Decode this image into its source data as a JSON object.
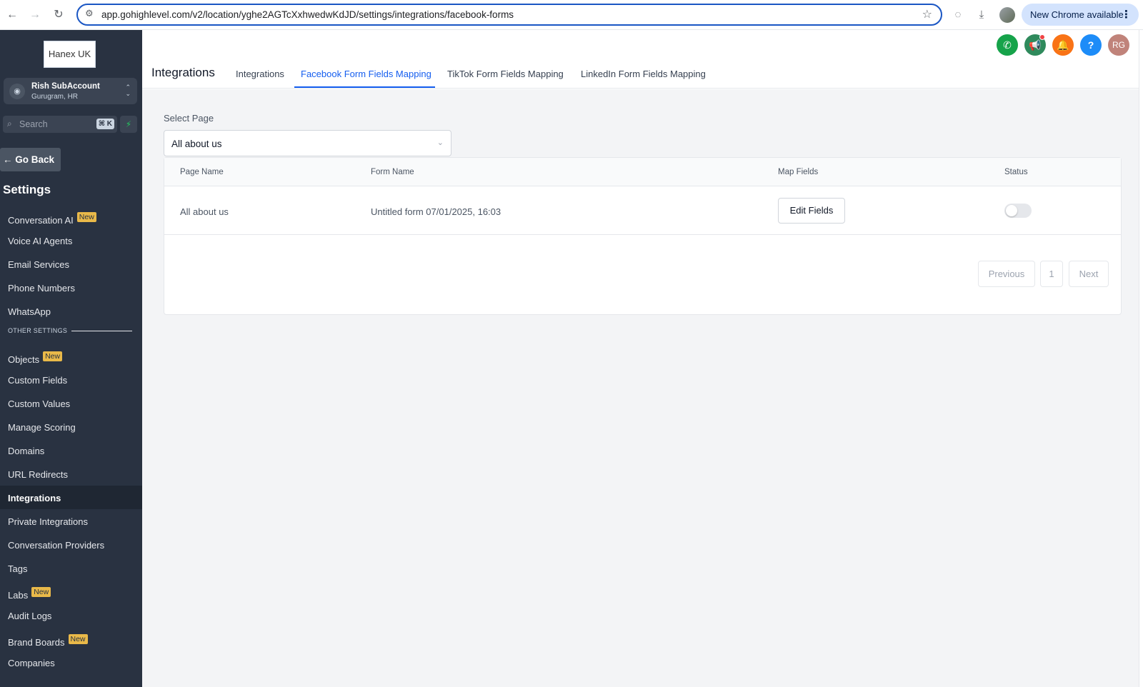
{
  "browser": {
    "url": "app.gohighlevel.com/v2/location/yghe2AGTcXxhwedwKdJD/settings/integrations/facebook-forms",
    "new_chrome_label": "New Chrome available"
  },
  "sidebar": {
    "logo_text": "Hanex UK",
    "account_name": "Rish SubAccount",
    "account_location": "Gurugram, HR",
    "search_placeholder": "Search",
    "search_shortcut": "⌘ K",
    "go_back_label": "Go Back",
    "settings_title": "Settings",
    "new_badge": "New",
    "other_settings_label": "OTHER SETTINGS",
    "items": [
      {
        "label": "Conversation AI",
        "badge": "New"
      },
      {
        "label": "Voice AI Agents"
      },
      {
        "label": "Email Services"
      },
      {
        "label": "Phone Numbers"
      },
      {
        "label": "WhatsApp"
      }
    ],
    "other_items": [
      {
        "label": "Objects",
        "badge": "New"
      },
      {
        "label": "Custom Fields"
      },
      {
        "label": "Custom Values"
      },
      {
        "label": "Manage Scoring"
      },
      {
        "label": "Domains"
      },
      {
        "label": "URL Redirects"
      },
      {
        "label": "Integrations",
        "active": true
      },
      {
        "label": "Private Integrations"
      },
      {
        "label": "Conversation Providers"
      },
      {
        "label": "Tags"
      },
      {
        "label": "Labs",
        "badge": "New"
      },
      {
        "label": "Audit Logs"
      },
      {
        "label": "Brand Boards",
        "badge": "New"
      },
      {
        "label": "Companies"
      }
    ]
  },
  "header": {
    "title": "Integrations",
    "tabs": [
      {
        "label": "Integrations"
      },
      {
        "label": "Facebook Form Fields Mapping",
        "active": true
      },
      {
        "label": "TikTok Form Fields Mapping"
      },
      {
        "label": "LinkedIn Form Fields Mapping"
      }
    ],
    "user_initials": "RG",
    "help_label": "?"
  },
  "main": {
    "select_label": "Select Page",
    "selected_page": "All about us",
    "table": {
      "columns": [
        "Page Name",
        "Form Name",
        "Map Fields",
        "Status"
      ],
      "rows": [
        {
          "page_name": "All about us",
          "form_name": "Untitled form 07/01/2025, 16:03",
          "action": "Edit Fields",
          "status": false
        }
      ]
    },
    "pagination": {
      "previous": "Previous",
      "current_page": "1",
      "next": "Next"
    }
  },
  "colors": {
    "sidebar_bg": "#293241",
    "accent": "#155eef",
    "badge": "#e9b949",
    "phone_btn": "#16a34a",
    "megaphone_btn": "#2f8a5c",
    "bell_btn": "#f97316",
    "help_btn": "#1d8cf8",
    "avatar_btn": "#c0837a"
  }
}
